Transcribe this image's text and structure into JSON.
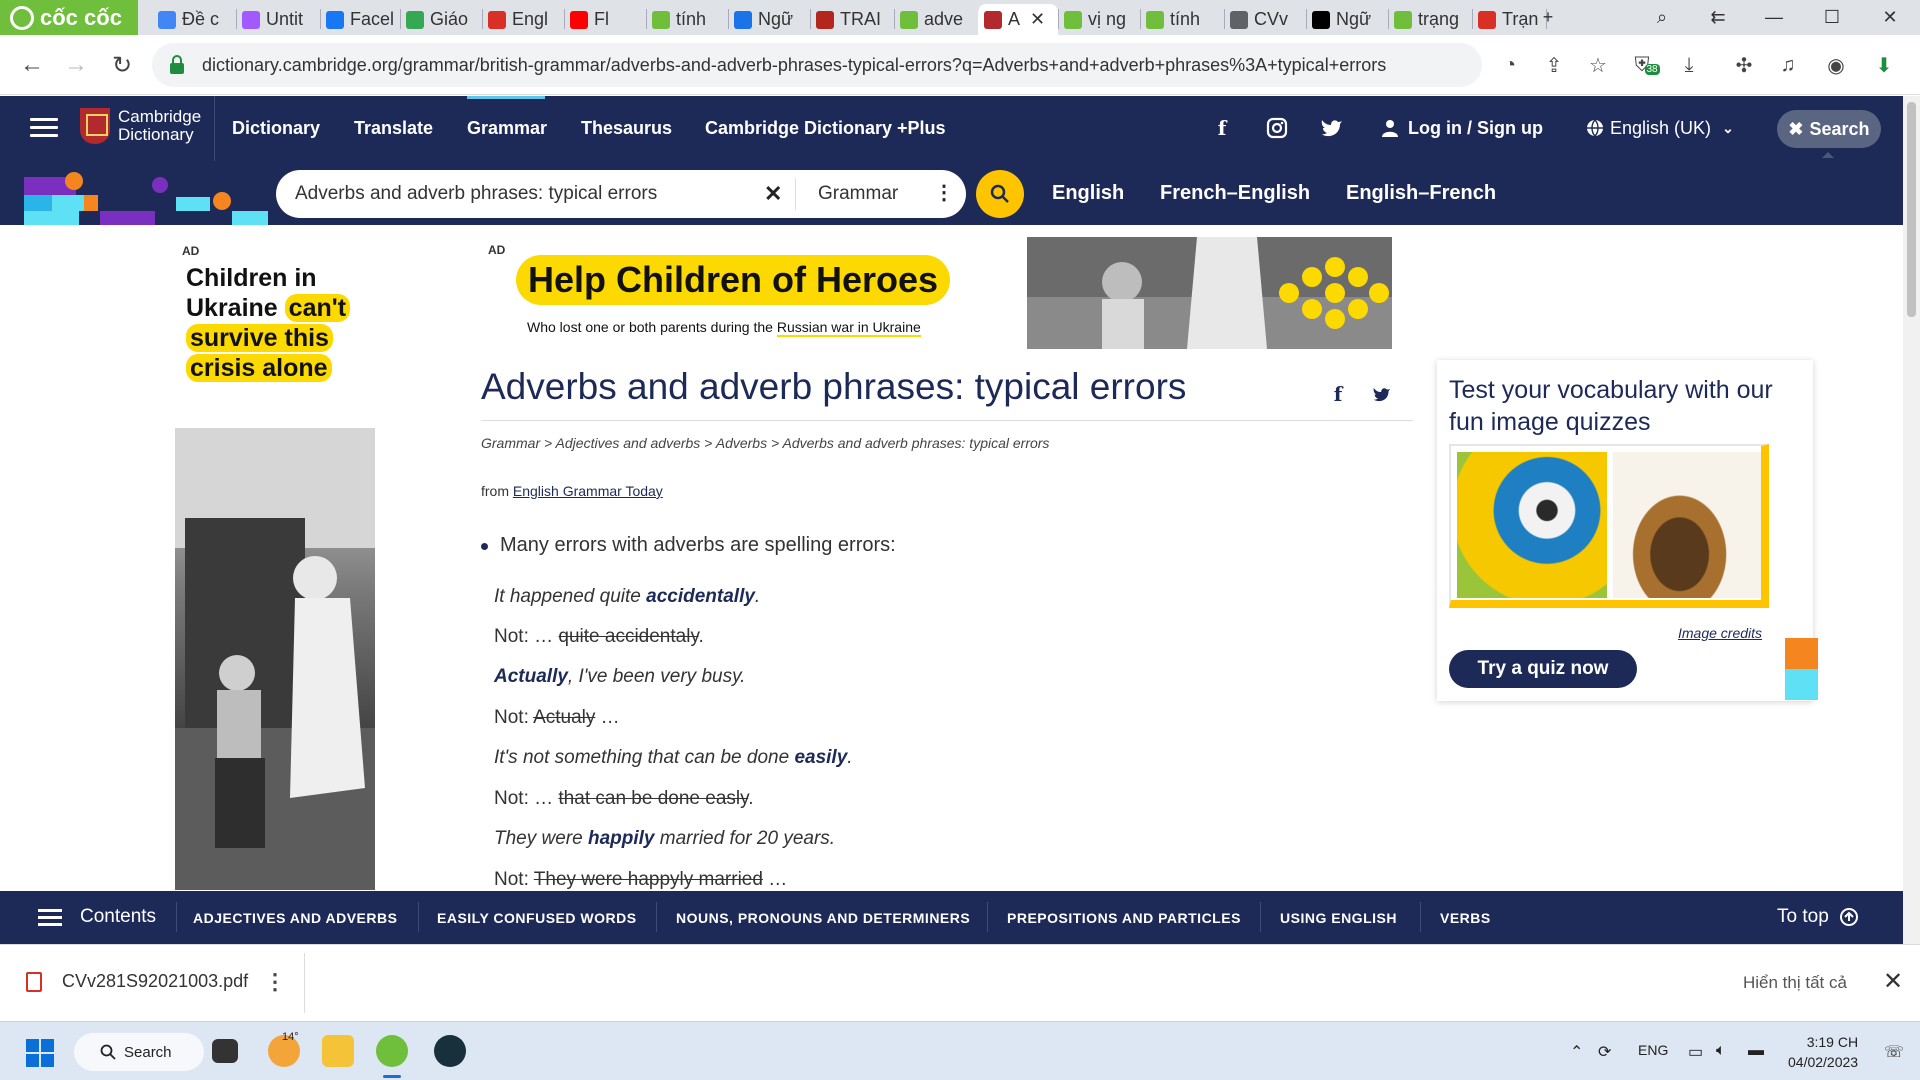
{
  "browser": {
    "brand": "cốc cốc",
    "tabs": [
      {
        "label": "Đề c",
        "color": "#4285f4"
      },
      {
        "label": "Untit",
        "color": "#a259ff"
      },
      {
        "label": "Facel",
        "color": "#1877f2"
      },
      {
        "label": "Giáo",
        "color": "#34a853"
      },
      {
        "label": "Engl",
        "color": "#d93025"
      },
      {
        "label": "Fl",
        "color": "#ff0000"
      },
      {
        "label": "tính",
        "color": "#6fbe3c"
      },
      {
        "label": "Ngữ",
        "color": "#1a73e8"
      },
      {
        "label": "TRAI",
        "color": "#b3261e"
      },
      {
        "label": "adve",
        "color": "#6fbe3c"
      },
      {
        "label": "A",
        "color": "#b2292e"
      },
      {
        "label": "vị ng",
        "color": "#6fbe3c"
      },
      {
        "label": "tính",
        "color": "#6fbe3c"
      },
      {
        "label": "CVv",
        "color": "#5f6368"
      },
      {
        "label": "Ngữ",
        "color": "#000000"
      },
      {
        "label": "trạng",
        "color": "#6fbe3c"
      },
      {
        "label": "Trạn",
        "color": "#d93025"
      }
    ],
    "active_tab_index": 10,
    "url": "dictionary.cambridge.org/grammar/british-grammar/adverbs-and-adverb-phrases-typical-errors?q=Adverbs+and+adverb+phrases%3A+typical+errors",
    "extension_badge": "38"
  },
  "site": {
    "logo_line1": "Cambridge",
    "logo_line2": "Dictionary",
    "nav": [
      "Dictionary",
      "Translate",
      "Grammar",
      "Thesaurus",
      "Cambridge Dictionary +Plus"
    ],
    "login": "Log in / Sign up",
    "language": "English (UK)",
    "search_pill": "Search",
    "search_value": "Adverbs and adverb phrases: typical errors",
    "dictionary_select": "Grammar",
    "dict_links": [
      "English",
      "French–English",
      "English–French"
    ]
  },
  "ads": {
    "label": "AD",
    "left_line1": "Children in",
    "left_line2a": "Ukraine ",
    "left_line2b": "can't",
    "left_line3": "survive this",
    "left_line4": "crisis alone",
    "banner_title": "Help Children of Heroes",
    "banner_sub_a": "Who lost one or both parents during the ",
    "banner_sub_b": "Russian war in Ukraine"
  },
  "article": {
    "title": "Adverbs and adverb phrases: typical errors",
    "breadcrumb": "Grammar > Adjectives and adverbs > Adverbs > Adverbs and adverb phrases: typical errors",
    "from_prefix": "from ",
    "from_link": "English Grammar Today",
    "bullet": "Many errors with adverbs are spelling errors:",
    "ex1_a": "It happened quite ",
    "ex1_b": "accidentally",
    "ex1_c": ".",
    "ex2_a": "Not: … ",
    "ex2_b": "quite accidentaly",
    "ex2_c": ".",
    "ex3_b": "Actually",
    "ex3_c": ", I've been very busy.",
    "ex4_a": "Not: ",
    "ex4_b": "Actualy",
    "ex4_c": " …",
    "ex5_a": "It's not something that can be done ",
    "ex5_b": "easily",
    "ex5_c": ".",
    "ex6_a": "Not: … ",
    "ex6_b": "that can be done easly",
    "ex6_c": ".",
    "ex7_a": "They were ",
    "ex7_b": "happily",
    "ex7_c": " married for 20 years.",
    "ex8_a": "Not: ",
    "ex8_b": "They were happyly married",
    "ex8_c": " …"
  },
  "quiz": {
    "title": "Test your vocabulary with our fun image quizzes",
    "credits": "Image credits",
    "button": "Try a quiz now"
  },
  "contents_bar": {
    "label": "Contents",
    "links": [
      "ADJECTIVES AND ADVERBS",
      "EASILY CONFUSED WORDS",
      "NOUNS, PRONOUNS AND DETERMINERS",
      "PREPOSITIONS AND PARTICLES",
      "USING ENGLISH",
      "VERBS"
    ],
    "to_top": "To top"
  },
  "downloads": {
    "file": "CVv281S92021003.pdf",
    "show_all": "Hiển thị tất cả"
  },
  "taskbar": {
    "search": "Search",
    "weather": "14°",
    "lang": "ENG",
    "time": "3:19 CH",
    "date": "04/02/2023"
  }
}
